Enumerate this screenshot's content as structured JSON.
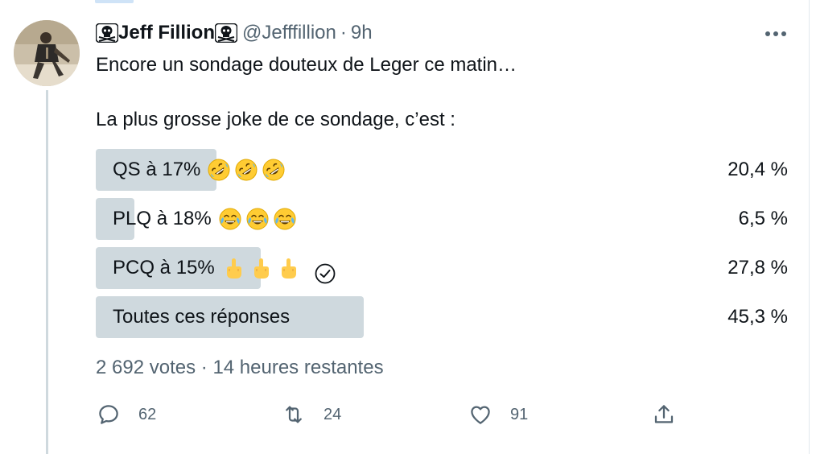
{
  "tweet": {
    "display_name": "Jeff Fillion",
    "handle": "@Jefffillion",
    "separator": "·",
    "time": "9h",
    "text_line1": "Encore un sondage douteux de Leger ce matin…",
    "text_line2": "La plus grosse joke de ce sondage, c’est :"
  },
  "poll": {
    "options": [
      {
        "label": "QS à 17%",
        "emoji": "rolling-on-floor-laughing",
        "emoji_count": 3,
        "percent_text": "20,4 %",
        "percent": 20.4,
        "selected": false
      },
      {
        "label": "PLQ à 18%",
        "emoji": "face-with-tears-of-joy",
        "emoji_count": 3,
        "percent_text": "6,5 %",
        "percent": 6.5,
        "selected": false
      },
      {
        "label": "PCQ à 15%",
        "emoji": "middle-finger",
        "emoji_count": 3,
        "percent_text": "27,8 %",
        "percent": 27.8,
        "selected": true
      },
      {
        "label": "Toutes ces réponses",
        "emoji": "",
        "emoji_count": 0,
        "percent_text": "45,3 %",
        "percent": 45.3,
        "selected": false
      }
    ],
    "votes": "2 692 votes",
    "separator": "·",
    "remaining": "14 heures restantes"
  },
  "actions": {
    "replies": "62",
    "retweets": "24",
    "likes": "91"
  },
  "colors": {
    "bar": "#cfd9de",
    "text": "#0f1419",
    "secondary": "#536471",
    "thread": "#cfd9de"
  },
  "icons": [
    "skull-crossbones-icon",
    "more-icon",
    "check-circle-icon",
    "reply-icon",
    "retweet-icon",
    "like-icon",
    "share-icon"
  ]
}
